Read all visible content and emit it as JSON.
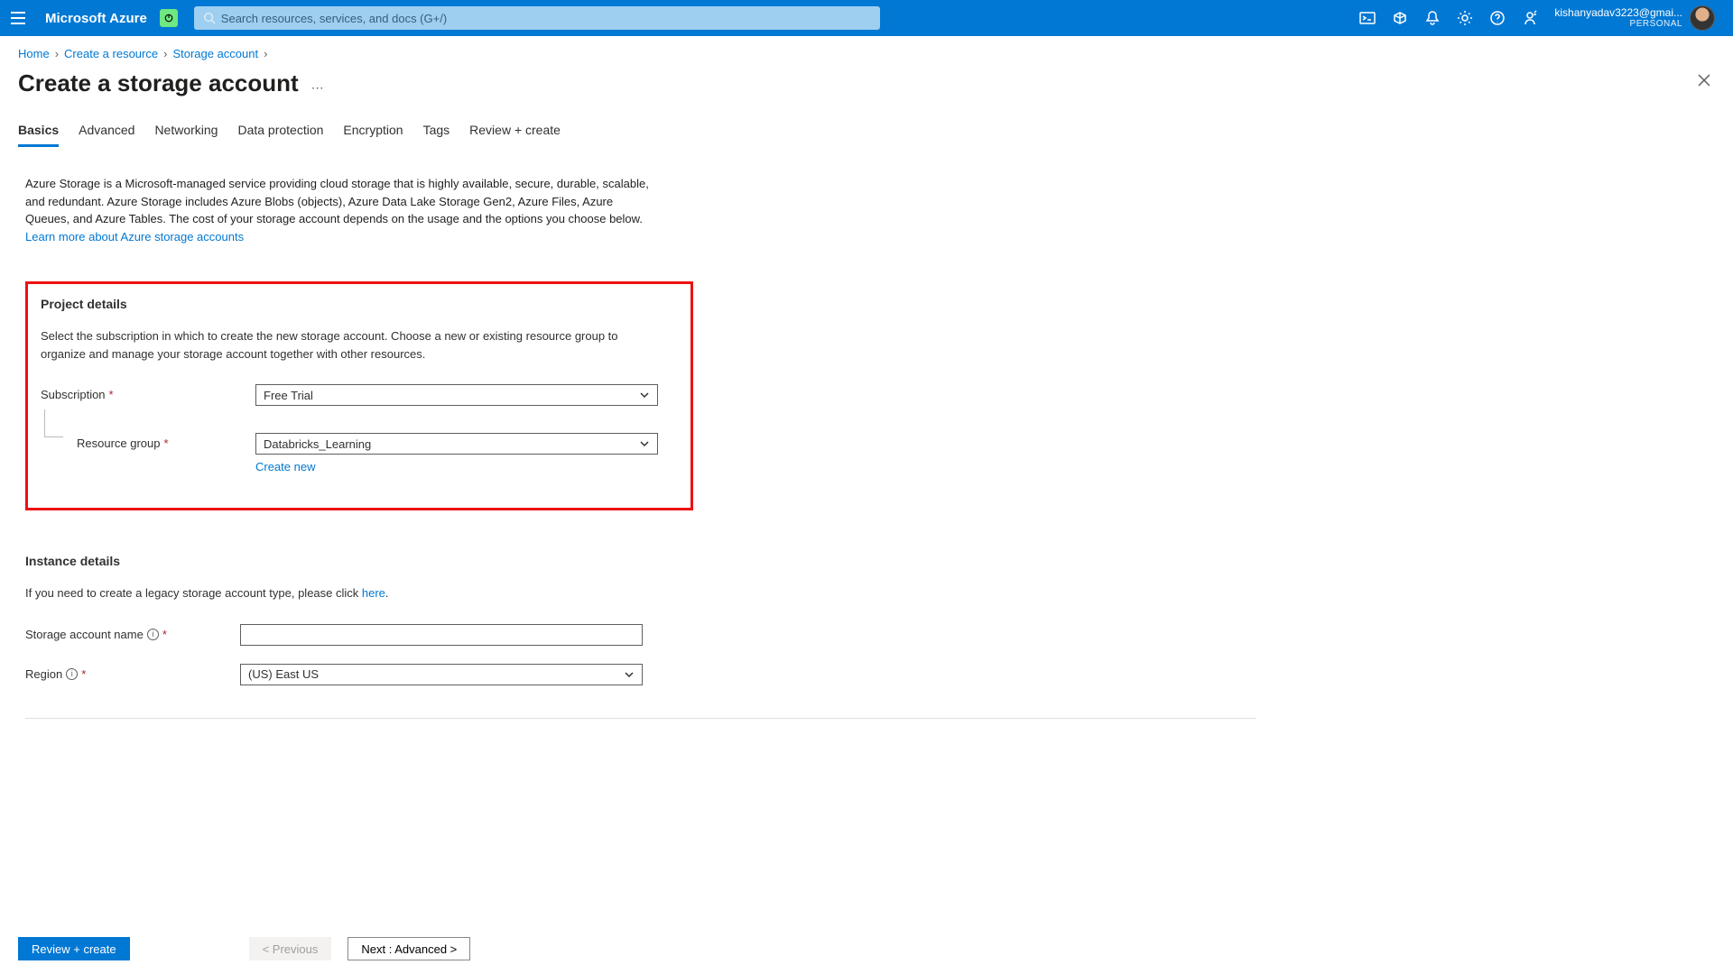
{
  "topbar": {
    "brand": "Microsoft Azure",
    "search_placeholder": "Search resources, services, and docs (G+/)",
    "account_email": "kishanyadav3223@gmai...",
    "account_directory": "PERSONAL"
  },
  "breadcrumb": {
    "items": [
      "Home",
      "Create a resource",
      "Storage account"
    ]
  },
  "page": {
    "title": "Create a storage account"
  },
  "tabs": {
    "items": [
      {
        "label": "Basics",
        "active": true
      },
      {
        "label": "Advanced",
        "active": false
      },
      {
        "label": "Networking",
        "active": false
      },
      {
        "label": "Data protection",
        "active": false
      },
      {
        "label": "Encryption",
        "active": false
      },
      {
        "label": "Tags",
        "active": false
      },
      {
        "label": "Review + create",
        "active": false
      }
    ]
  },
  "intro": {
    "text": "Azure Storage is a Microsoft-managed service providing cloud storage that is highly available, secure, durable, scalable, and redundant. Azure Storage includes Azure Blobs (objects), Azure Data Lake Storage Gen2, Azure Files, Azure Queues, and Azure Tables. The cost of your storage account depends on the usage and the options you choose below. ",
    "link": "Learn more about Azure storage accounts"
  },
  "project_details": {
    "heading": "Project details",
    "description": "Select the subscription in which to create the new storage account. Choose a new or existing resource group to organize and manage your storage account together with other resources.",
    "subscription_label": "Subscription",
    "subscription_value": "Free Trial",
    "resource_group_label": "Resource group",
    "resource_group_value": "Databricks_Learning",
    "create_new": "Create new"
  },
  "instance_details": {
    "heading": "Instance details",
    "legacy_text": "If you need to create a legacy storage account type, please click ",
    "legacy_link": "here",
    "storage_name_label": "Storage account name",
    "storage_name_value": "",
    "region_label": "Region",
    "region_value": "(US) East US"
  },
  "footer": {
    "review": "Review + create",
    "previous": "< Previous",
    "next": "Next : Advanced >"
  }
}
